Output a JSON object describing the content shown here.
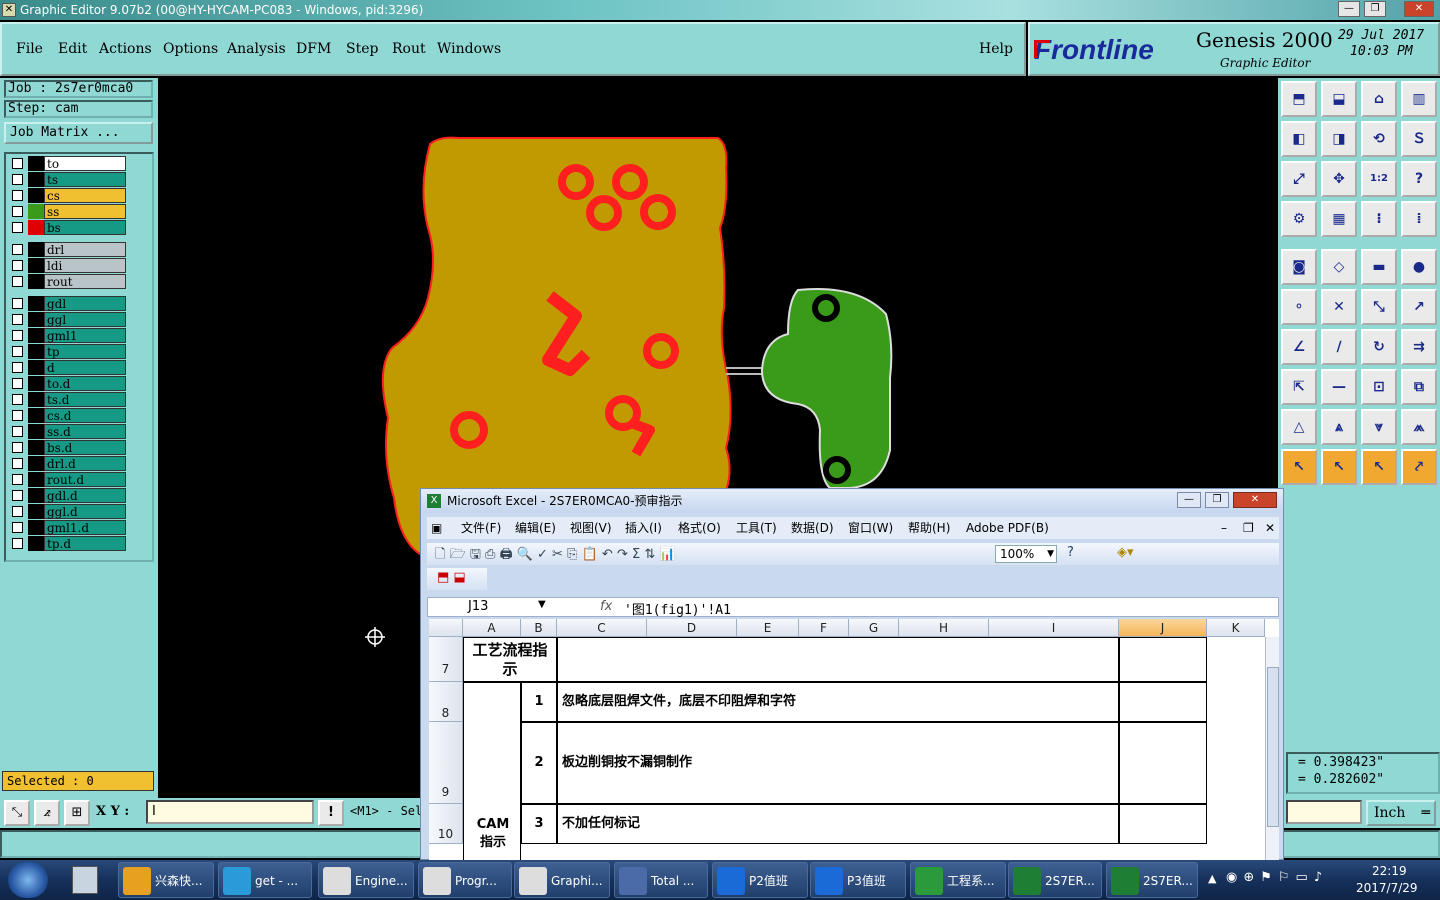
{
  "window": {
    "title": "Graphic Editor 9.07b2 (00@HY-HYCAM-PC083 - Windows, pid:3296)"
  },
  "menu": [
    "File",
    "Edit",
    "Actions",
    "Options",
    "Analysis",
    "DFM",
    "Step",
    "Rout",
    "Windows"
  ],
  "help": "Help",
  "brand": {
    "logo": "Frontline",
    "product": "Genesis 2000",
    "sub": "Graphic Editor",
    "date": "29 Jul 2017",
    "time": "10:03 PM"
  },
  "job": {
    "job_label": "Job : 2s7er0mca0",
    "step_label": "Step: cam",
    "matrix_button": "Job Matrix ..."
  },
  "layers": [
    {
      "name": "to",
      "color": "#ffffff",
      "swatch": "#000000",
      "mark": "⬋"
    },
    {
      "name": "ts",
      "color": "#169a86",
      "swatch": "#000000",
      "mark": ""
    },
    {
      "name": "cs",
      "color": "#f0c030",
      "swatch": "#000000",
      "mark": "⬋"
    },
    {
      "name": "ss",
      "color": "#f0c030",
      "swatch": "#3a9a1a",
      "mark": "⬋"
    },
    {
      "name": "bs",
      "color": "#169a86",
      "swatch": "#e00000",
      "mark": "⊞"
    },
    {
      "name": "drl",
      "color": "#b8c4c8",
      "swatch": "#000000",
      "mark": ""
    },
    {
      "name": "ldi",
      "color": "#b8c4c8",
      "swatch": "#000000",
      "mark": ""
    },
    {
      "name": "rout",
      "color": "#b8c4c8",
      "swatch": "#000000",
      "mark": ""
    },
    {
      "name": "gdl",
      "color": "#169a86",
      "swatch": "#000000",
      "mark": "⬋"
    },
    {
      "name": "ggl",
      "color": "#169a86",
      "swatch": "#000000",
      "mark": ""
    },
    {
      "name": "gml1",
      "color": "#169a86",
      "swatch": "#000000",
      "mark": "⬋"
    },
    {
      "name": "tp",
      "color": "#169a86",
      "swatch": "#000000",
      "mark": ""
    },
    {
      "name": "d",
      "color": "#169a86",
      "swatch": "#000000",
      "mark": ""
    },
    {
      "name": "to.d",
      "color": "#169a86",
      "swatch": "#000000",
      "mark": "⬋"
    },
    {
      "name": "ts.d",
      "color": "#169a86",
      "swatch": "#000000",
      "mark": ""
    },
    {
      "name": "cs.d",
      "color": "#169a86",
      "swatch": "#000000",
      "mark": "⬋"
    },
    {
      "name": "ss.d",
      "color": "#169a86",
      "swatch": "#000000",
      "mark": "⬋"
    },
    {
      "name": "bs.d",
      "color": "#169a86",
      "swatch": "#000000",
      "mark": ""
    },
    {
      "name": "drl.d",
      "color": "#169a86",
      "swatch": "#000000",
      "mark": ""
    },
    {
      "name": "rout.d",
      "color": "#169a86",
      "swatch": "#000000",
      "mark": ""
    },
    {
      "name": "gdl.d",
      "color": "#169a86",
      "swatch": "#000000",
      "mark": "⬋"
    },
    {
      "name": "ggl.d",
      "color": "#169a86",
      "swatch": "#000000",
      "mark": ""
    },
    {
      "name": "gml1.d",
      "color": "#169a86",
      "swatch": "#000000",
      "mark": "⬋"
    },
    {
      "name": "tp.d",
      "color": "#169a86",
      "swatch": "#000000",
      "mark": ""
    }
  ],
  "selected": "Selected : 0",
  "coords": {
    "x": "= 0.398423\"",
    "y": "= 0.282602\""
  },
  "xy_label": "X Y :",
  "xy_value": "I",
  "mode_text": "<M1> - Sel",
  "units": "Inch",
  "excel": {
    "title": "Microsoft Excel - 2S7ER0MCA0-预审指示",
    "menu": [
      "文件(F)",
      "编辑(E)",
      "视图(V)",
      "插入(I)",
      "格式(O)",
      "工具(T)",
      "数据(D)",
      "窗口(W)",
      "帮助(H)",
      "Adobe PDF(B)"
    ],
    "zoom": "100%",
    "cellref": "J13",
    "formula": "'图1(fig1)'!A1",
    "columns": [
      "A",
      "B",
      "C",
      "D",
      "E",
      "F",
      "G",
      "H",
      "I",
      "J",
      "K"
    ],
    "rows": [
      {
        "num": "7",
        "label": "工艺流程指示"
      },
      {
        "num": "8",
        "idx": "1",
        "text": "忽略底层阻焊文件，底层不印阻焊和字符"
      },
      {
        "num": "9",
        "idx": "2",
        "text": "板边削铜按不漏铜制作"
      },
      {
        "num": "10",
        "idx": "3",
        "text": "不加任何标记"
      }
    ],
    "cam_label": "CAM指示"
  },
  "taskbar": {
    "items": [
      "兴森快...",
      "get - ...",
      "Engine...",
      "Progr...",
      "Graphi...",
      "Total ...",
      "P2值班",
      "P3值班",
      "工程系...",
      "2S7ER...",
      "2S7ER..."
    ],
    "time": "22:19",
    "date": "2017/7/29"
  }
}
